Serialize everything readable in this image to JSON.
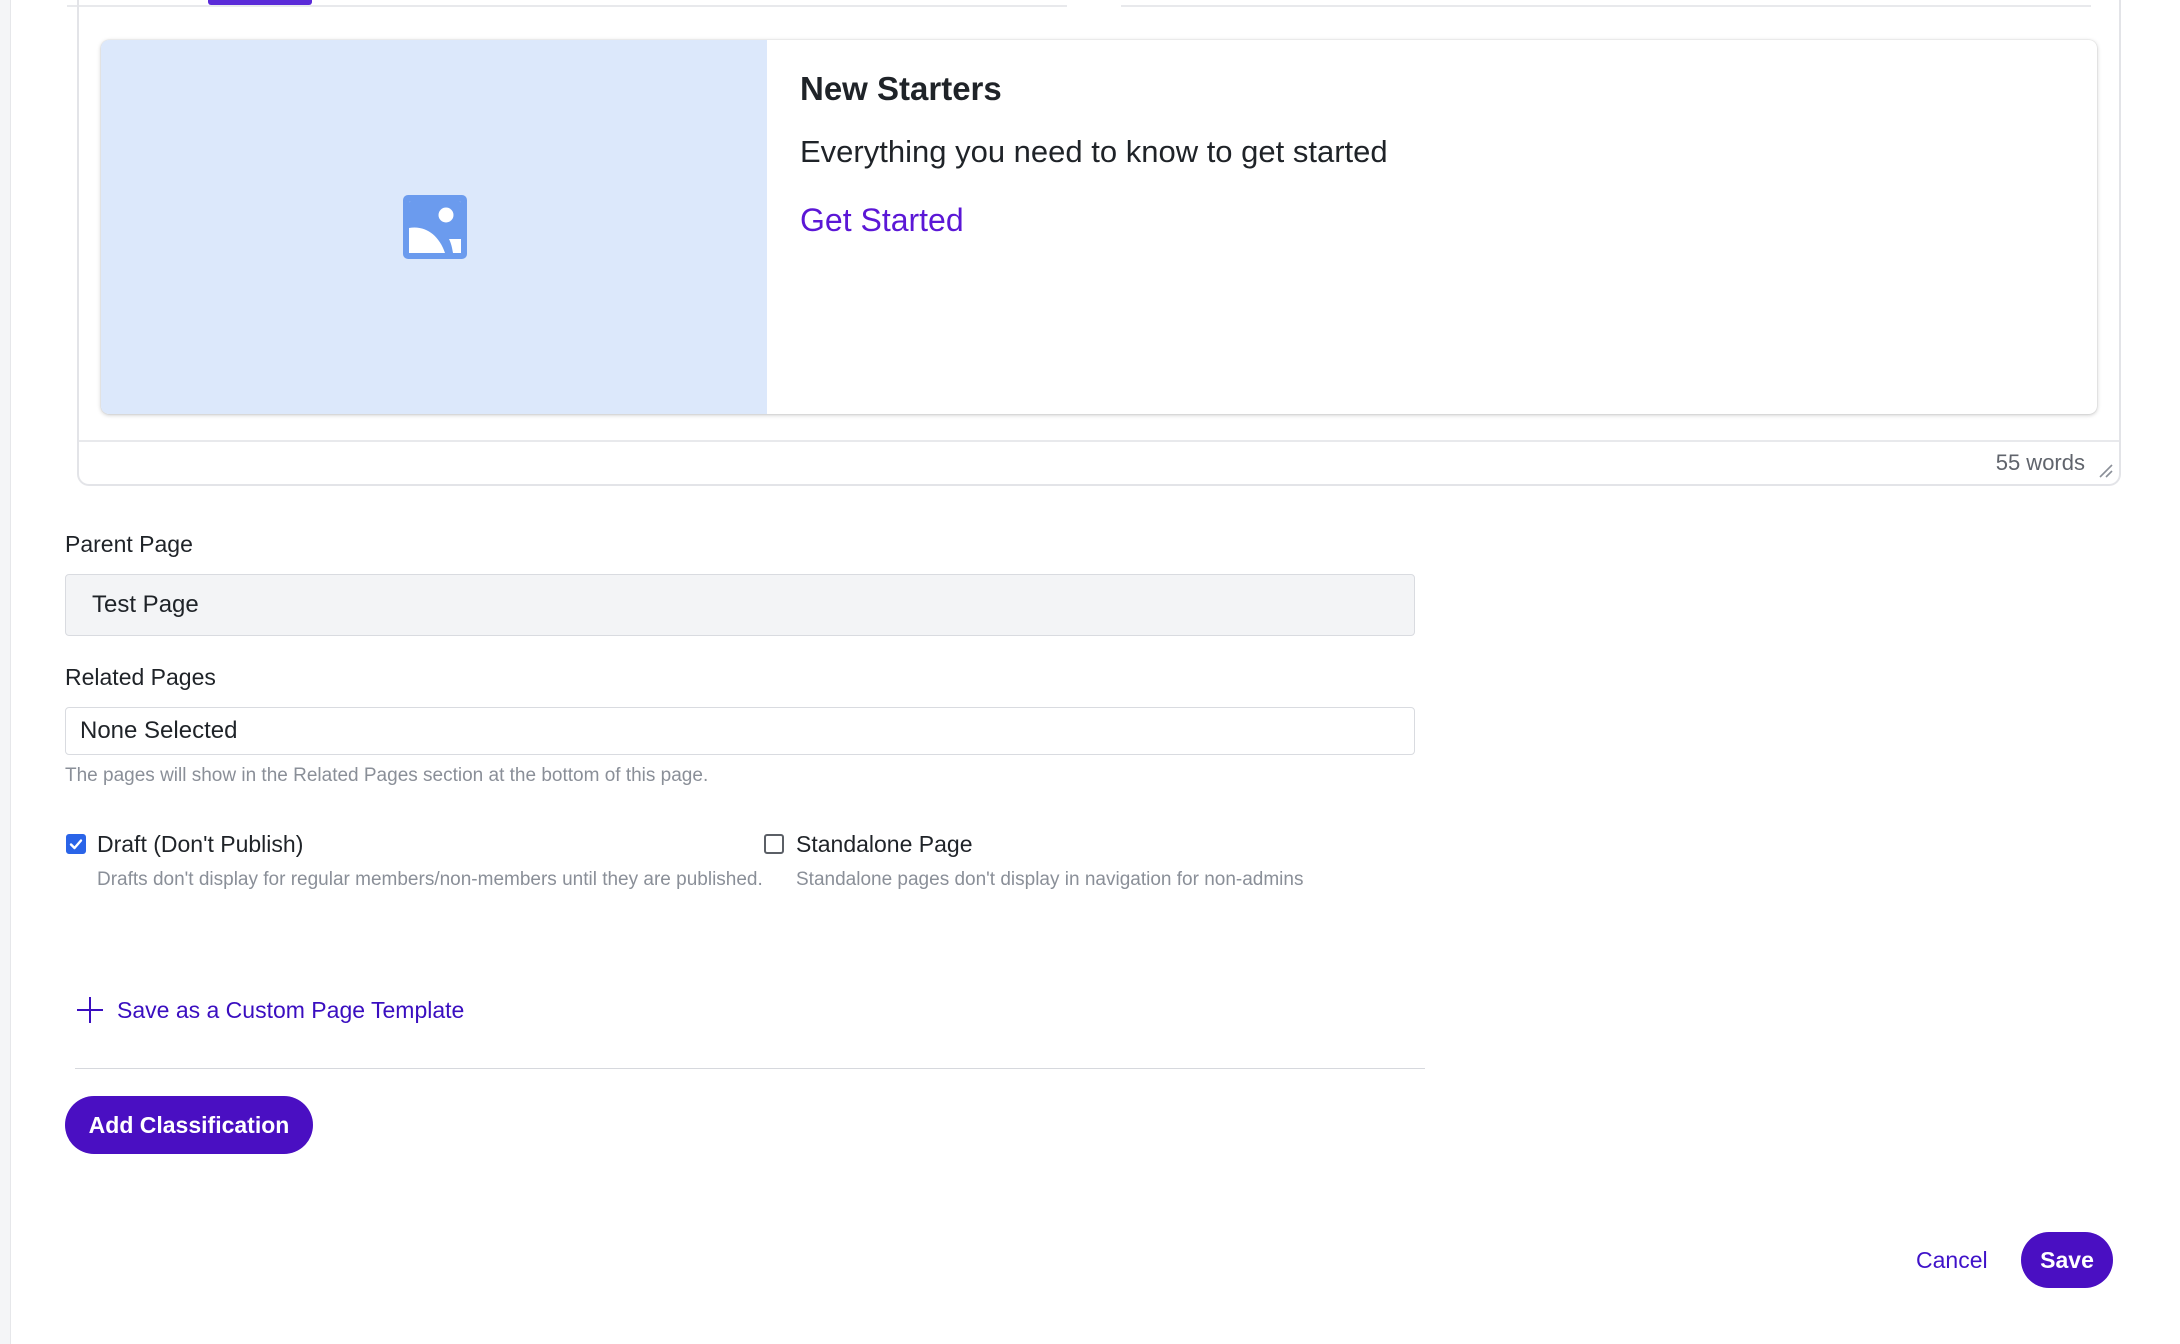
{
  "editor": {
    "word_count": "55 words"
  },
  "card": {
    "title": "New Starters",
    "text": "Everything you need to know to get started",
    "link_label": "Get Started",
    "media_icon": "image-icon"
  },
  "parent_page": {
    "label": "Parent Page",
    "value": "Test Page"
  },
  "related_pages": {
    "label": "Related Pages",
    "value": "None Selected",
    "help": "The pages will show in the Related Pages section at the bottom of this page."
  },
  "draft": {
    "label": "Draft (Don't Publish)",
    "checked": true,
    "help": "Drafts don't display for regular members/non-members until they are published."
  },
  "standalone": {
    "label": "Standalone Page",
    "checked": false,
    "help": "Standalone pages don't display in navigation for non-admins"
  },
  "template": {
    "label": "Save as a Custom Page Template"
  },
  "classification": {
    "button_label": "Add Classification"
  },
  "actions": {
    "cancel_label": "Cancel",
    "save_label": "Save"
  },
  "colors": {
    "accent": "#4a0fc2",
    "link": "#5b17d6",
    "checkbox": "#2a64e8",
    "media_bg": "#dce8fb"
  }
}
